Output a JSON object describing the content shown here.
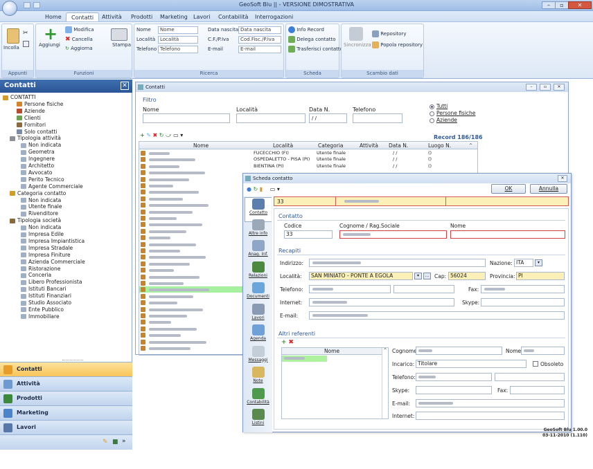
{
  "app": {
    "title": "GeoSoft Blu || - VERSIONE DIMOSTRATIVA"
  },
  "ribbon_tabs": [
    "Home",
    "Contatti",
    "Attività",
    "Prodotti",
    "Marketing",
    "Lavori",
    "Contabilità",
    "Interrogazioni"
  ],
  "ribbon": {
    "appunti": {
      "incolla": "Incolla",
      "label": "Appunti"
    },
    "funzioni": {
      "aggiungi": "Aggiungi",
      "modifica": "Modifica",
      "cancella": "Cancella",
      "aggiorna": "Aggiorna",
      "stampa": "Stampa",
      "label": "Funzioni"
    },
    "ricerca": {
      "nome_lbl": "Nome",
      "nome_ph": "Nome",
      "localita_lbl": "Località",
      "localita_ph": "Località",
      "telefono_lbl": "Telefono",
      "telefono_ph": "Telefono",
      "datanascita_lbl": "Data nascita",
      "datanascita_ph": "Data nascita",
      "cf_lbl": "C.F./P.Iva",
      "cf_ph": "Cod.Fisc./P.Iva",
      "email_lbl": "E-mail",
      "email_ph": "E-mail",
      "label": "Ricerca"
    },
    "scheda": {
      "info": "Info Record",
      "delega": "Delega contatto",
      "trasferisci": "Trasferisci contatto",
      "label": "Scheda"
    },
    "scambio": {
      "sincronizza": "Sincronizza",
      "repository": "Repository",
      "popola": "Popola repository",
      "label": "Scambio dati"
    }
  },
  "left_panel": {
    "title": "Contatti",
    "tree": [
      {
        "label": "CONTATTI",
        "level": 0
      },
      {
        "label": "Persone fisiche",
        "level": 2
      },
      {
        "label": "Aziende",
        "level": 2
      },
      {
        "label": "Clienti",
        "level": 2
      },
      {
        "label": "Fornitori",
        "level": 2
      },
      {
        "label": "Solo contatti",
        "level": 2
      },
      {
        "label": "Tipologia attività",
        "level": 1
      },
      {
        "label": "Non indicata",
        "level": 3
      },
      {
        "label": "Geometra",
        "level": 3
      },
      {
        "label": "Ingegnere",
        "level": 3
      },
      {
        "label": "Architetto",
        "level": 3
      },
      {
        "label": "Avvocato",
        "level": 3
      },
      {
        "label": "Perito Tecnico",
        "level": 3
      },
      {
        "label": "Agente Commerciale",
        "level": 3
      },
      {
        "label": "Categoria contatto",
        "level": 1
      },
      {
        "label": "Non indicata",
        "level": 3
      },
      {
        "label": "Utente finale",
        "level": 3
      },
      {
        "label": "Rivenditore",
        "level": 3
      },
      {
        "label": "Tipologia società",
        "level": 1
      },
      {
        "label": "Non indicata",
        "level": 3
      },
      {
        "label": "Impresa Edile",
        "level": 3
      },
      {
        "label": "Impresa Impiantistica",
        "level": 3
      },
      {
        "label": "Impresa Stradale",
        "level": 3
      },
      {
        "label": "Impresa Finiture",
        "level": 3
      },
      {
        "label": "Azienda Commerciale",
        "level": 3
      },
      {
        "label": "Ristorazione",
        "level": 3
      },
      {
        "label": "Conceria",
        "level": 3
      },
      {
        "label": "Libero Professionista",
        "level": 3
      },
      {
        "label": "Istituti Bancari",
        "level": 3
      },
      {
        "label": "Istituti Finanziari",
        "level": 3
      },
      {
        "label": "Studio Associato",
        "level": 3
      },
      {
        "label": "Ente Pubblico",
        "level": 3
      },
      {
        "label": "Immobiliare",
        "level": 3
      }
    ],
    "nav": [
      {
        "label": "Contatti",
        "color": "#e89d2b",
        "selected": true
      },
      {
        "label": "Attività",
        "color": "#6d9bd1",
        "selected": false
      },
      {
        "label": "Prodotti",
        "color": "#3a8a3a",
        "selected": false
      },
      {
        "label": "Marketing",
        "color": "#4b84c8",
        "selected": false
      },
      {
        "label": "Lavori",
        "color": "#5577aa",
        "selected": false
      }
    ]
  },
  "contatti_window": {
    "title": "Contatti",
    "filtro": {
      "label": "Filtro",
      "nome": "Nome",
      "localita": "Località",
      "data_n": "Data N.",
      "data_val": "/ /",
      "telefono": "Telefono"
    },
    "radios": [
      "Tutti",
      "Persone fisiche",
      "Aziende"
    ],
    "record": "Record 186/186",
    "columns": [
      "Nome",
      "Località",
      "Categoria",
      "Attività",
      "Data N.",
      "Luogo N."
    ],
    "rows": [
      {
        "localita": "FUCECCHIO (FI)",
        "categoria": "Utente finale",
        "data": "/ /",
        "luogo": "()"
      },
      {
        "localita": "OSPEDALETTO - PISA (PI)",
        "categoria": "Utente finale",
        "data": "/ /",
        "luogo": "()"
      },
      {
        "localita": "BIENTINA (PI)",
        "categoria": "Utente finale",
        "data": "/ /",
        "luogo": "()"
      }
    ]
  },
  "scheda_window": {
    "title": "Scheda contatto",
    "ok": "OK",
    "annulla": "Annulla",
    "id": "33",
    "tabs": [
      "Contatto",
      "Altre info",
      "Anag. Inf.",
      "Relazioni",
      "Documenti",
      "Lavori",
      "Agenda",
      "Messaggi",
      "Note",
      "Contabilità",
      "Listini"
    ],
    "contatto": {
      "section": "Contatto",
      "codice_lbl": "Codice",
      "codice_val": "33",
      "cognome_lbl": "Cognome / Rag.Sociale",
      "nome_lbl": "Nome"
    },
    "recapiti": {
      "section": "Recapiti",
      "indirizzo": "Indirizzo:",
      "nazione": "Nazione:",
      "nazione_val": "ITA",
      "localita": "Località:",
      "localita_val": "SAN MINIATO - PONTE A EGOLA",
      "cap": "Cap:",
      "cap_val": "56024",
      "provincia": "Provincia:",
      "provincia_val": "PI",
      "telefono": "Telefono:",
      "fax": "Fax:",
      "internet": "Internet:",
      "skype": "Skype:",
      "email": "E-mail:"
    },
    "altri": {
      "section": "Altri referenti",
      "nome_col": "Nome",
      "cognome": "Cognome:",
      "nome": "Nome:",
      "incarico": "Incarico:",
      "incarico_val": "Titolare",
      "obsoleto": "Obsoleto",
      "telefono": "Telefono:",
      "skype": "Skype:",
      "fax": "Fax:",
      "email": "E-mail:",
      "internet": "Internet:"
    }
  },
  "status": {
    "line1": "GeoSoft Blu 1.00.0",
    "line2": "03-11-2010 (1.110)"
  }
}
